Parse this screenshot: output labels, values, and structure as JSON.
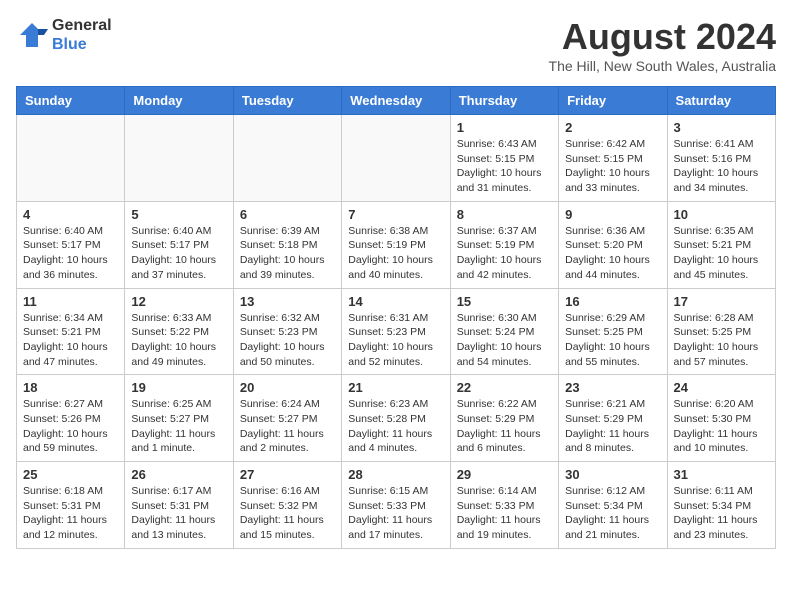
{
  "header": {
    "logo_general": "General",
    "logo_blue": "Blue",
    "month_year": "August 2024",
    "location": "The Hill, New South Wales, Australia"
  },
  "days_of_week": [
    "Sunday",
    "Monday",
    "Tuesday",
    "Wednesday",
    "Thursday",
    "Friday",
    "Saturday"
  ],
  "weeks": [
    [
      {
        "day": "",
        "info": ""
      },
      {
        "day": "",
        "info": ""
      },
      {
        "day": "",
        "info": ""
      },
      {
        "day": "",
        "info": ""
      },
      {
        "day": "1",
        "info": "Sunrise: 6:43 AM\nSunset: 5:15 PM\nDaylight: 10 hours\nand 31 minutes."
      },
      {
        "day": "2",
        "info": "Sunrise: 6:42 AM\nSunset: 5:15 PM\nDaylight: 10 hours\nand 33 minutes."
      },
      {
        "day": "3",
        "info": "Sunrise: 6:41 AM\nSunset: 5:16 PM\nDaylight: 10 hours\nand 34 minutes."
      }
    ],
    [
      {
        "day": "4",
        "info": "Sunrise: 6:40 AM\nSunset: 5:17 PM\nDaylight: 10 hours\nand 36 minutes."
      },
      {
        "day": "5",
        "info": "Sunrise: 6:40 AM\nSunset: 5:17 PM\nDaylight: 10 hours\nand 37 minutes."
      },
      {
        "day": "6",
        "info": "Sunrise: 6:39 AM\nSunset: 5:18 PM\nDaylight: 10 hours\nand 39 minutes."
      },
      {
        "day": "7",
        "info": "Sunrise: 6:38 AM\nSunset: 5:19 PM\nDaylight: 10 hours\nand 40 minutes."
      },
      {
        "day": "8",
        "info": "Sunrise: 6:37 AM\nSunset: 5:19 PM\nDaylight: 10 hours\nand 42 minutes."
      },
      {
        "day": "9",
        "info": "Sunrise: 6:36 AM\nSunset: 5:20 PM\nDaylight: 10 hours\nand 44 minutes."
      },
      {
        "day": "10",
        "info": "Sunrise: 6:35 AM\nSunset: 5:21 PM\nDaylight: 10 hours\nand 45 minutes."
      }
    ],
    [
      {
        "day": "11",
        "info": "Sunrise: 6:34 AM\nSunset: 5:21 PM\nDaylight: 10 hours\nand 47 minutes."
      },
      {
        "day": "12",
        "info": "Sunrise: 6:33 AM\nSunset: 5:22 PM\nDaylight: 10 hours\nand 49 minutes."
      },
      {
        "day": "13",
        "info": "Sunrise: 6:32 AM\nSunset: 5:23 PM\nDaylight: 10 hours\nand 50 minutes."
      },
      {
        "day": "14",
        "info": "Sunrise: 6:31 AM\nSunset: 5:23 PM\nDaylight: 10 hours\nand 52 minutes."
      },
      {
        "day": "15",
        "info": "Sunrise: 6:30 AM\nSunset: 5:24 PM\nDaylight: 10 hours\nand 54 minutes."
      },
      {
        "day": "16",
        "info": "Sunrise: 6:29 AM\nSunset: 5:25 PM\nDaylight: 10 hours\nand 55 minutes."
      },
      {
        "day": "17",
        "info": "Sunrise: 6:28 AM\nSunset: 5:25 PM\nDaylight: 10 hours\nand 57 minutes."
      }
    ],
    [
      {
        "day": "18",
        "info": "Sunrise: 6:27 AM\nSunset: 5:26 PM\nDaylight: 10 hours\nand 59 minutes."
      },
      {
        "day": "19",
        "info": "Sunrise: 6:25 AM\nSunset: 5:27 PM\nDaylight: 11 hours\nand 1 minute."
      },
      {
        "day": "20",
        "info": "Sunrise: 6:24 AM\nSunset: 5:27 PM\nDaylight: 11 hours\nand 2 minutes."
      },
      {
        "day": "21",
        "info": "Sunrise: 6:23 AM\nSunset: 5:28 PM\nDaylight: 11 hours\nand 4 minutes."
      },
      {
        "day": "22",
        "info": "Sunrise: 6:22 AM\nSunset: 5:29 PM\nDaylight: 11 hours\nand 6 minutes."
      },
      {
        "day": "23",
        "info": "Sunrise: 6:21 AM\nSunset: 5:29 PM\nDaylight: 11 hours\nand 8 minutes."
      },
      {
        "day": "24",
        "info": "Sunrise: 6:20 AM\nSunset: 5:30 PM\nDaylight: 11 hours\nand 10 minutes."
      }
    ],
    [
      {
        "day": "25",
        "info": "Sunrise: 6:18 AM\nSunset: 5:31 PM\nDaylight: 11 hours\nand 12 minutes."
      },
      {
        "day": "26",
        "info": "Sunrise: 6:17 AM\nSunset: 5:31 PM\nDaylight: 11 hours\nand 13 minutes."
      },
      {
        "day": "27",
        "info": "Sunrise: 6:16 AM\nSunset: 5:32 PM\nDaylight: 11 hours\nand 15 minutes."
      },
      {
        "day": "28",
        "info": "Sunrise: 6:15 AM\nSunset: 5:33 PM\nDaylight: 11 hours\nand 17 minutes."
      },
      {
        "day": "29",
        "info": "Sunrise: 6:14 AM\nSunset: 5:33 PM\nDaylight: 11 hours\nand 19 minutes."
      },
      {
        "day": "30",
        "info": "Sunrise: 6:12 AM\nSunset: 5:34 PM\nDaylight: 11 hours\nand 21 minutes."
      },
      {
        "day": "31",
        "info": "Sunrise: 6:11 AM\nSunset: 5:34 PM\nDaylight: 11 hours\nand 23 minutes."
      }
    ]
  ]
}
